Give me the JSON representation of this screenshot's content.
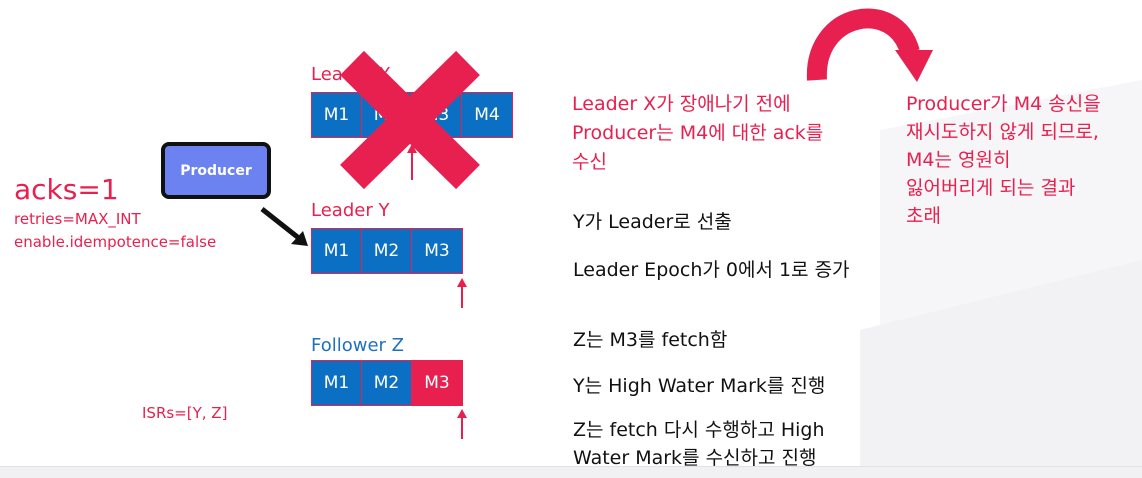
{
  "colors": {
    "accent": "#e8204f",
    "blue": "#0b6fc4",
    "producer": "#6b82f0",
    "text": "#111111"
  },
  "config": {
    "acks": "acks=1",
    "retries": "retries=MAX_INT",
    "idempotence": "enable.idempotence=false",
    "isrs": "ISRs=[Y, Z]"
  },
  "producer": {
    "label": "Producer"
  },
  "leader_x": {
    "label": "Leader X",
    "cells": [
      "M1",
      "M2",
      "M3",
      "M4"
    ]
  },
  "leader_y": {
    "label": "Leader Y",
    "cells": [
      "M1",
      "M2",
      "M3"
    ]
  },
  "follower_z": {
    "label": "Follower Z",
    "cells": [
      "M1",
      "M2",
      "M3"
    ]
  },
  "notes": {
    "x_failure_1": "Leader X가 장애나기 전에",
    "x_failure_2": "Producer는 M4에 대한 ack를",
    "x_failure_3": "수신",
    "result_1": "Producer가 M4 송신을",
    "result_2": "재시도하지 않게 되므로,",
    "result_3": "M4는 영원히",
    "result_4": "잃어버리게 되는 결과",
    "result_5": "초래",
    "step1": "Y가 Leader로 선출",
    "step2": "Leader Epoch가 0에서 1로 증가",
    "step3": "Z는 M3를 fetch함",
    "step4": "Y는 High Water Mark를 진행",
    "step5_1": "Z는 fetch 다시 수행하고 High",
    "step5_2": "Water Mark를 수신하고 진행"
  },
  "icons": [
    "cross-icon",
    "curved-arrow-icon",
    "arrow-icon",
    "up-arrow-icon"
  ]
}
